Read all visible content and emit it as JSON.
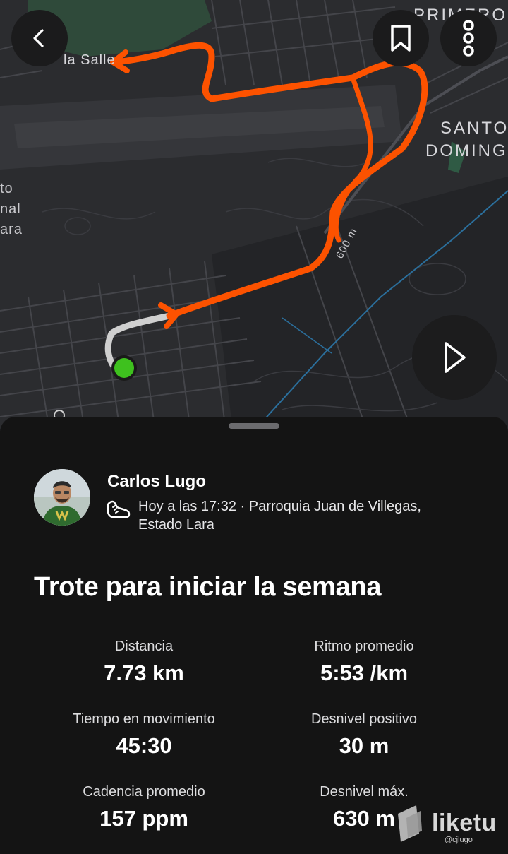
{
  "map": {
    "labels": {
      "la_salle": "la Salle",
      "primero": "PRIMERO",
      "santo": "SANTO",
      "domingo": "DOMINGO",
      "to": "to",
      "nal": "nal",
      "ara": "ara",
      "scale": "600 m"
    },
    "route_color": "#fc5200",
    "start_color": "#3ec11e"
  },
  "toolbar": {
    "back_icon": "chevron-left-icon",
    "bookmark_icon": "bookmark-icon",
    "more_icon": "more-vertical-icon",
    "play_icon": "play-icon"
  },
  "activity": {
    "athlete_name": "Carlos Lugo",
    "sport_icon": "running-shoe-icon",
    "time_line": "Hoy a las 17:32 · Parroquia Juan de Villegas,",
    "location_line": "Estado Lara",
    "title": "Trote para iniciar la semana"
  },
  "stats": [
    {
      "label": "Distancia",
      "value": "7.73 km"
    },
    {
      "label": "Ritmo promedio",
      "value": "5:53 /km"
    },
    {
      "label": "Tiempo en movimiento",
      "value": "45:30"
    },
    {
      "label": "Desnivel positivo",
      "value": "30 m"
    },
    {
      "label": "Cadencia promedio",
      "value": "157 ppm"
    },
    {
      "label": "Desnivel máx.",
      "value": "630 m"
    }
  ],
  "watermark": {
    "brand": "liketu",
    "user": "@cjlugo"
  }
}
